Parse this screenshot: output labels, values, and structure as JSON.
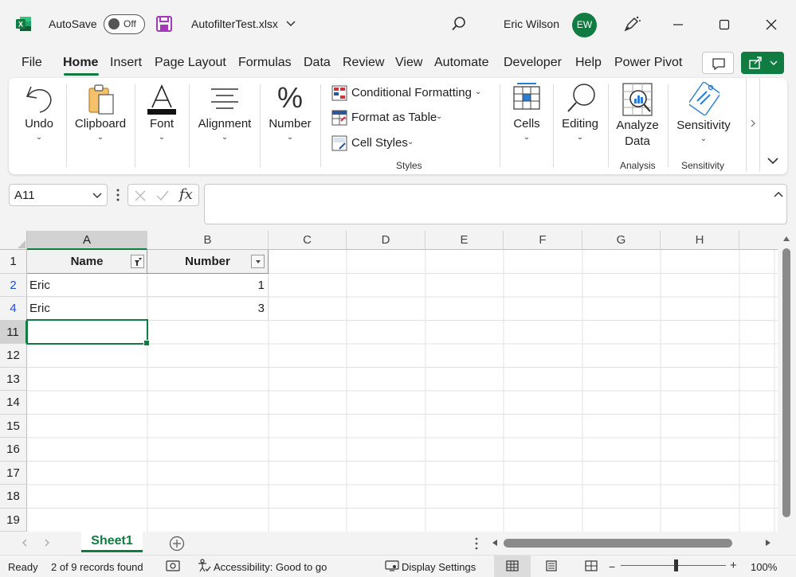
{
  "titlebar": {
    "autosave_label": "AutoSave",
    "autosave_state": "Off",
    "filename": "AutofilterTest.xlsx",
    "user_name": "Eric Wilson",
    "user_initials": "EW"
  },
  "menu": {
    "tabs": [
      "File",
      "Home",
      "Insert",
      "Page Layout",
      "Formulas",
      "Data",
      "Review",
      "View",
      "Automate",
      "Developer",
      "Help",
      "Power Pivot"
    ],
    "active": "Home"
  },
  "ribbon": {
    "undo": "Undo",
    "clipboard": "Clipboard",
    "font": "Font",
    "alignment": "Alignment",
    "number": "Number",
    "conditional_formatting": "Conditional Formatting",
    "format_as_table": "Format as Table",
    "cell_styles": "Cell Styles",
    "styles_group": "Styles",
    "cells": "Cells",
    "editing": "Editing",
    "analyze_line1": "Analyze",
    "analyze_line2": "Data",
    "analysis_group": "Analysis",
    "sensitivity": "Sensitivity",
    "sensitivity_group": "Sensitivity"
  },
  "formula_bar": {
    "name_box": "A11",
    "fx": "fx",
    "value": ""
  },
  "grid": {
    "columns": [
      "A",
      "B",
      "C",
      "D",
      "E",
      "F",
      "G",
      "H"
    ],
    "selected_column": "A",
    "rows": [
      "1",
      "2",
      "4",
      "11",
      "12",
      "13",
      "14",
      "15",
      "16",
      "17",
      "18",
      "19"
    ],
    "selected_row": "11",
    "header": {
      "name": "Name",
      "number": "Number"
    },
    "data": [
      {
        "name": "Eric",
        "number": "1"
      },
      {
        "name": "Eric",
        "number": "3"
      }
    ]
  },
  "sheets": {
    "active": "Sheet1"
  },
  "status": {
    "ready": "Ready",
    "records": "2 of 9 records found",
    "accessibility": "Accessibility: Good to go",
    "display_settings": "Display Settings",
    "zoom": "100%"
  },
  "colors": {
    "accent": "#107c41",
    "filtered_row_number": "#1d4ed8"
  }
}
